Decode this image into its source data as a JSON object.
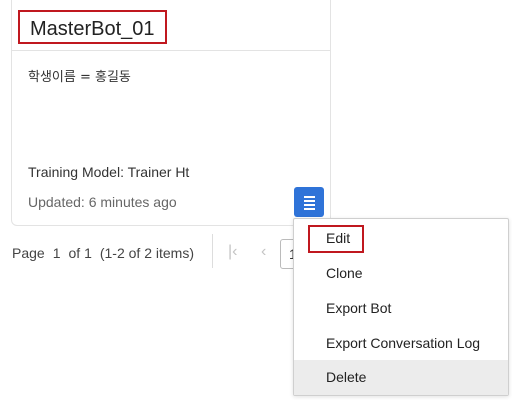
{
  "card": {
    "title": "MasterBot_01",
    "variable": "학생이름 = 홍길동",
    "training_model": "Training Model: Trainer Ht",
    "updated": "Updated: 6 minutes ago",
    "menu_icon": "list-menu-icon",
    "accent_color": "#2f73d8"
  },
  "pagination": {
    "page_label": "Page",
    "current_page": "1",
    "of_label": "of 1",
    "items_label": "(1-2 of 2 items)",
    "first_icon": "first-page-icon",
    "prev_icon": "previous-page-icon",
    "page_input_value": "1"
  },
  "menu": {
    "items": [
      {
        "label": "Edit"
      },
      {
        "label": "Clone"
      },
      {
        "label": "Export Bot"
      },
      {
        "label": "Export Conversation Log"
      },
      {
        "label": "Delete"
      }
    ],
    "highlighted_item": "Delete",
    "highlight_color": "#ececec"
  },
  "annotation_color": "#c0181f"
}
